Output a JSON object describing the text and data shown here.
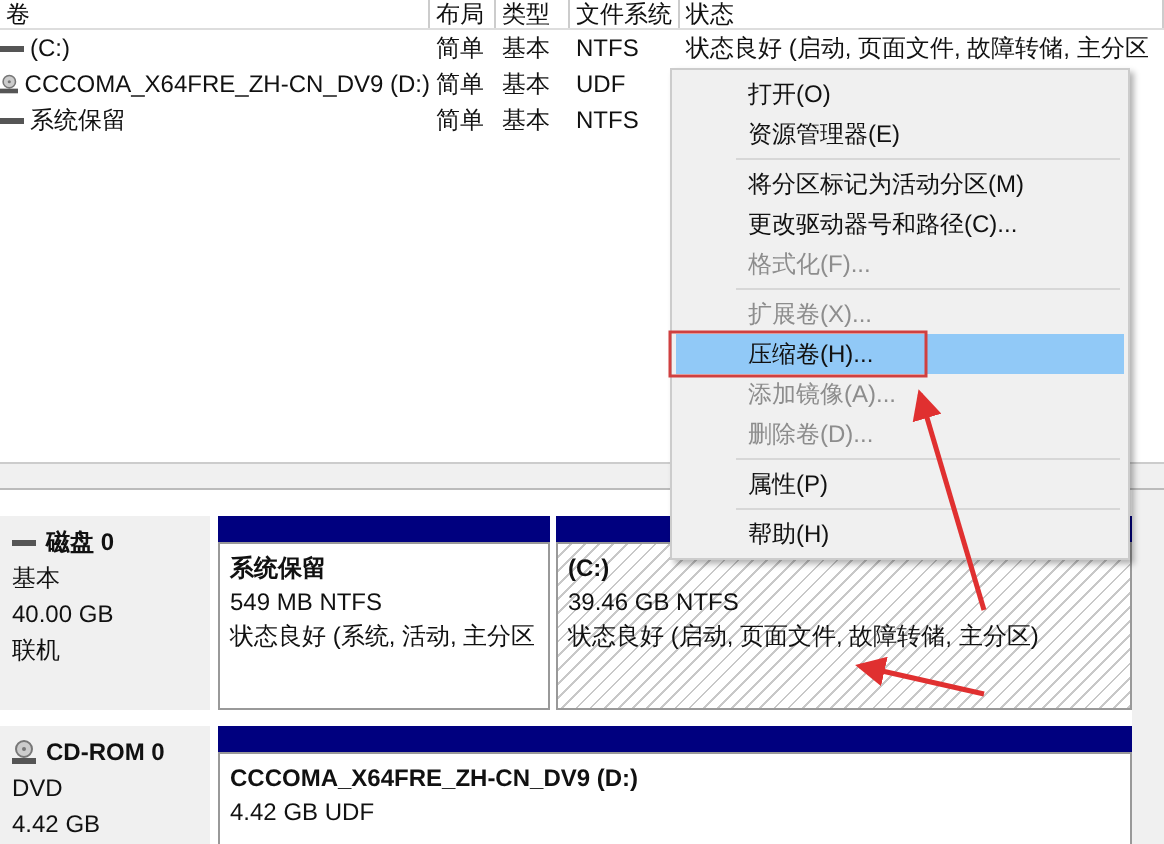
{
  "volumes_table": {
    "columns": [
      "卷",
      "布局",
      "类型",
      "文件系统",
      "状态"
    ],
    "rows": [
      {
        "kind": "disk",
        "cells": [
          "(C:)",
          "简单",
          "基本",
          "NTFS",
          "状态良好 (启动, 页面文件, 故障转储, 主分区"
        ]
      },
      {
        "kind": "cdrom",
        "cells": [
          "CCCOMA_X64FRE_ZH-CN_DV9 (D:)",
          "简单",
          "基本",
          "UDF",
          ""
        ]
      },
      {
        "kind": "disk",
        "cells": [
          "系统保留",
          "简单",
          "基本",
          "NTFS",
          ""
        ]
      }
    ]
  },
  "disks": [
    {
      "kind": "disk",
      "name": "磁盘 0",
      "lines": [
        "基本",
        "40.00 GB",
        "联机"
      ],
      "partitions": [
        {
          "title": "系统保留",
          "details": [
            "549 MB NTFS",
            "状态良好 (系统, 活动, 主分区"
          ],
          "selected": false
        },
        {
          "title": "(C:)",
          "details": [
            "39.46 GB NTFS",
            "状态良好 (启动, 页面文件, 故障转储, 主分区)"
          ],
          "selected": true
        }
      ]
    },
    {
      "kind": "cdrom",
      "name": "CD-ROM 0",
      "lines": [
        "DVD",
        "4.42 GB"
      ],
      "partitions": [
        {
          "title": "CCCOMA_X64FRE_ZH-CN_DV9  (D:)",
          "details": [
            "4.42 GB UDF"
          ],
          "selected": false
        }
      ]
    }
  ],
  "context_menu": [
    {
      "kind": "item",
      "label": "打开(O)",
      "disabled": false,
      "selected": false
    },
    {
      "kind": "item",
      "label": "资源管理器(E)",
      "disabled": false,
      "selected": false
    },
    {
      "kind": "separator"
    },
    {
      "kind": "item",
      "label": "将分区标记为活动分区(M)",
      "disabled": false,
      "selected": false
    },
    {
      "kind": "item",
      "label": "更改驱动器号和路径(C)...",
      "disabled": false,
      "selected": false
    },
    {
      "kind": "item",
      "label": "格式化(F)...",
      "disabled": true,
      "selected": false
    },
    {
      "kind": "separator"
    },
    {
      "kind": "item",
      "label": "扩展卷(X)...",
      "disabled": true,
      "selected": false
    },
    {
      "kind": "item",
      "label": "压缩卷(H)...",
      "disabled": false,
      "selected": true
    },
    {
      "kind": "item",
      "label": "添加镜像(A)...",
      "disabled": true,
      "selected": false
    },
    {
      "kind": "item",
      "label": "删除卷(D)...",
      "disabled": true,
      "selected": false
    },
    {
      "kind": "separator"
    },
    {
      "kind": "item",
      "label": "属性(P)",
      "disabled": false,
      "selected": false
    },
    {
      "kind": "separator"
    },
    {
      "kind": "item",
      "label": "帮助(H)",
      "disabled": false,
      "selected": false
    }
  ]
}
